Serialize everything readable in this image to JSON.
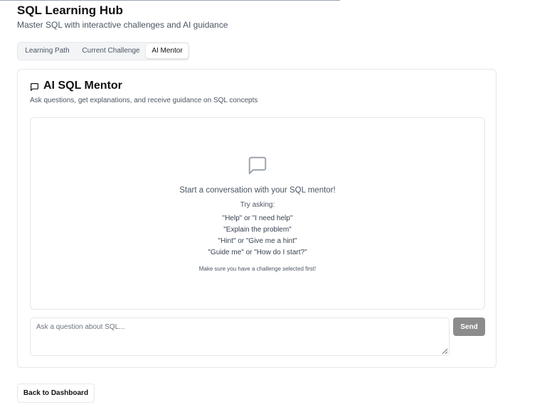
{
  "header": {
    "title": "SQL Learning Hub",
    "subtitle": "Master SQL with interactive challenges and AI guidance"
  },
  "tabs": [
    {
      "label": "Learning Path",
      "active": false
    },
    {
      "label": "Current Challenge",
      "active": false
    },
    {
      "label": "AI Mentor",
      "active": true
    }
  ],
  "mentor": {
    "icon": "message-square-icon",
    "title": "AI SQL Mentor",
    "description": "Ask questions, get explanations, and receive guidance on SQL concepts",
    "empty_state": {
      "icon": "message-square-icon",
      "title": "Start a conversation with your SQL mentor!",
      "try_asking": "Try asking:",
      "suggestions": [
        "\"Help\" or \"I need help\"",
        "\"Explain the problem\"",
        "\"Hint\" or \"Give me a hint\"",
        "\"Guide me\" or \"How do I start?\""
      ],
      "note": "Make sure you have a challenge selected first!"
    },
    "input": {
      "placeholder": "Ask a question about SQL...",
      "value": ""
    },
    "send_label": "Send"
  },
  "footer": {
    "back_label": "Back to Dashboard"
  },
  "colors": {
    "send_button_bg": "#8c8c8c",
    "border": "#e5e7eb",
    "muted_text": "#4b5563"
  }
}
